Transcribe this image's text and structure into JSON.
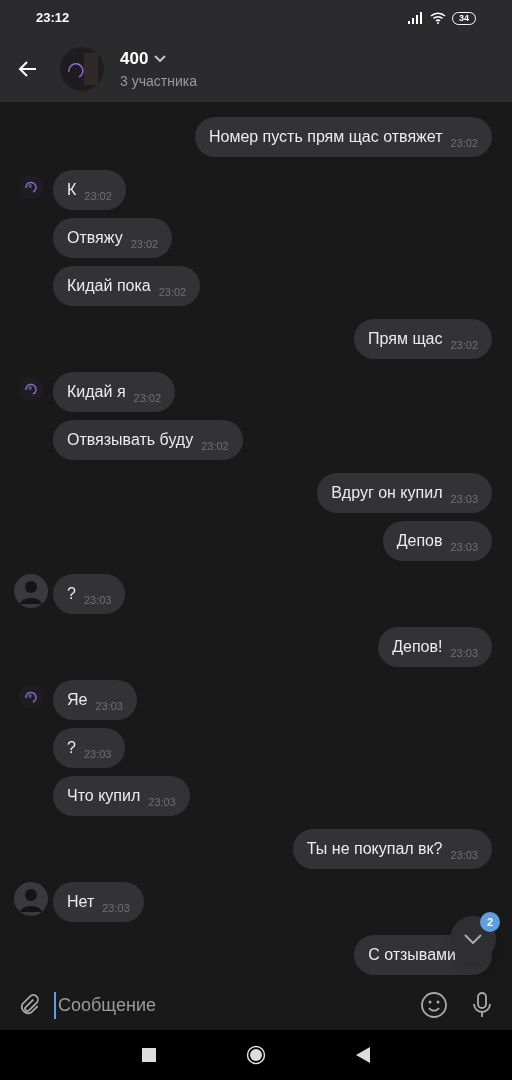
{
  "status_bar": {
    "time": "23:12",
    "battery": "34"
  },
  "header": {
    "title": "400",
    "subtitle": "3 участника"
  },
  "messages": [
    {
      "kind": "sent",
      "text": "Номер пусть прям щас отвяжет",
      "time": "23:02"
    },
    {
      "kind": "first_spiral",
      "text": "К",
      "time": "23:02"
    },
    {
      "kind": "received",
      "text": "Отвяжу",
      "time": "23:02"
    },
    {
      "kind": "received",
      "text": "Кидай пока",
      "time": "23:02"
    },
    {
      "kind": "sent",
      "text": "Прям щас",
      "time": "23:02"
    },
    {
      "kind": "first_spiral",
      "text": "Кидай я",
      "time": "23:02"
    },
    {
      "kind": "received",
      "text": "Отвязывать буду",
      "time": "23:02"
    },
    {
      "kind": "sent",
      "text": "Вдруг он купил",
      "time": "23:03"
    },
    {
      "kind": "sent",
      "text": "Депов",
      "time": "23:03"
    },
    {
      "kind": "first_photo",
      "text": "?",
      "time": "23:03"
    },
    {
      "kind": "sent",
      "text": "Депов!",
      "time": "23:03"
    },
    {
      "kind": "first_spiral",
      "text": "Яе",
      "time": "23:03"
    },
    {
      "kind": "received",
      "text": "?",
      "time": "23:03"
    },
    {
      "kind": "received",
      "text": "Что купил",
      "time": "23:03"
    },
    {
      "kind": "sent",
      "text": "Ты не покупал вк?",
      "time": "23:03"
    },
    {
      "kind": "first_photo",
      "text": "Нет",
      "time": "23:03"
    },
    {
      "kind": "sent",
      "text": "С отзывами"
    }
  ],
  "scroll_button": {
    "badge": "2"
  },
  "composer": {
    "placeholder": "Сообщение"
  }
}
